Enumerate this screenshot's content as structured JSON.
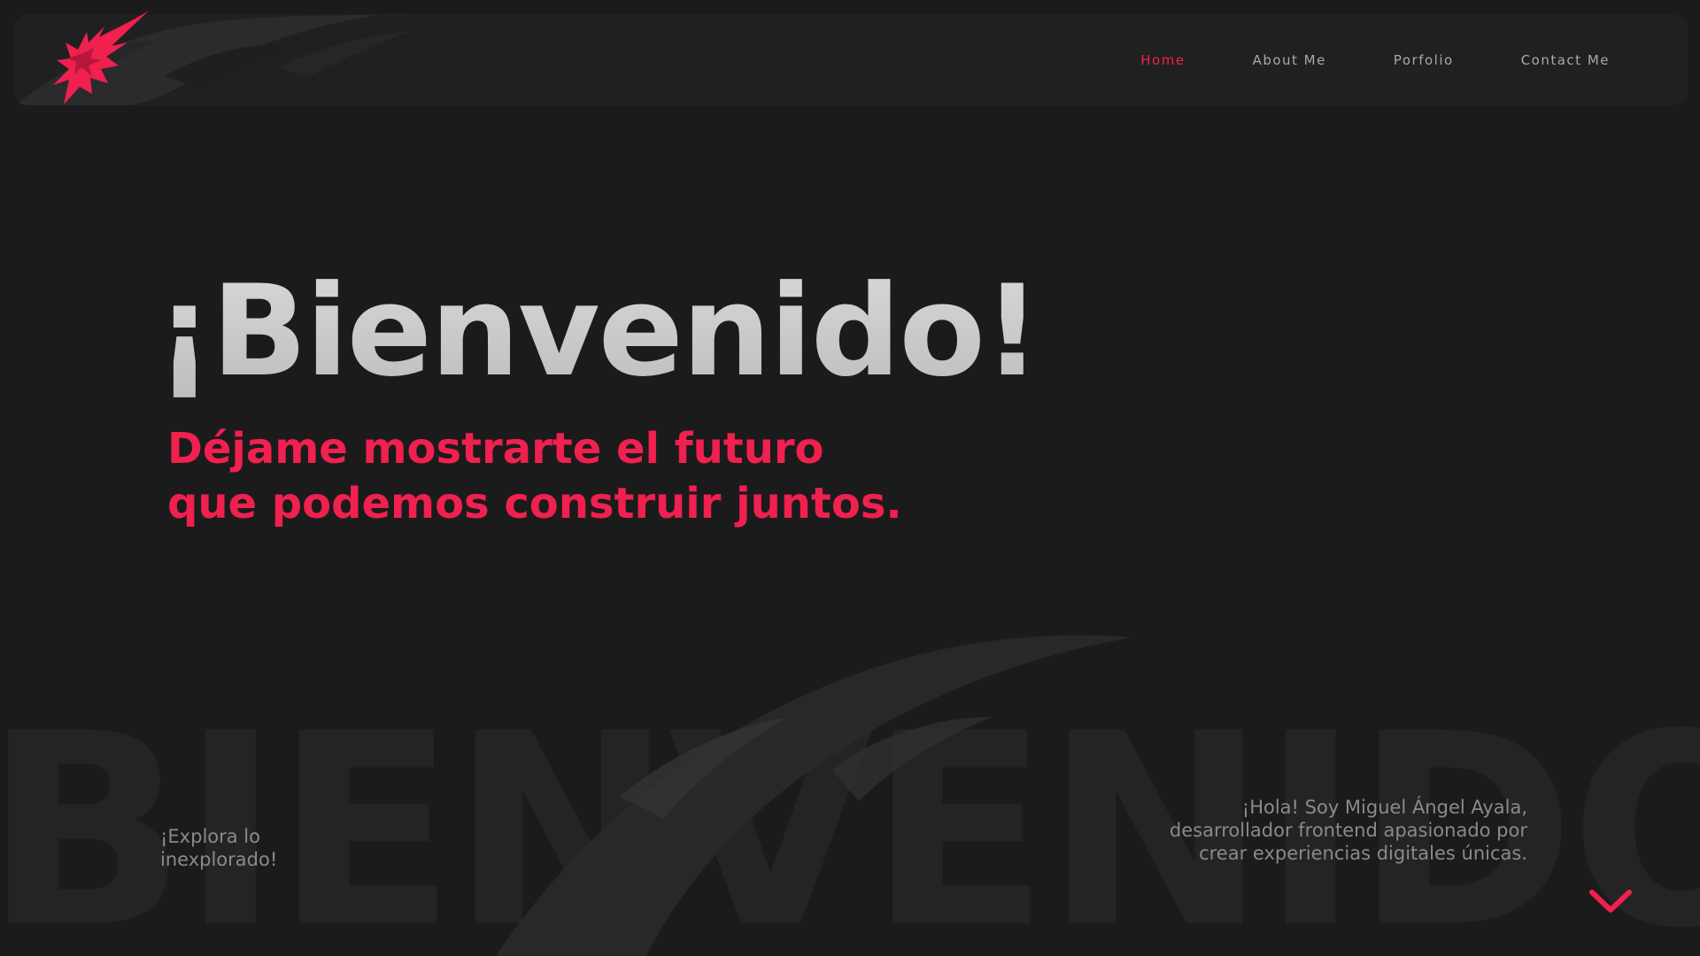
{
  "nav": {
    "items": [
      {
        "label": "Home"
      },
      {
        "label": "About Me"
      },
      {
        "label": "Porfolio"
      },
      {
        "label": "Contact Me"
      }
    ]
  },
  "hero": {
    "title": "¡Bienvenido!",
    "subtitle_line1": "Déjame mostrarte el futuro",
    "subtitle_line2": "que podemos construir juntos."
  },
  "background_word": "BIENVENIDO",
  "footer": {
    "explore_line1": "¡Explora lo",
    "explore_line2": "inexplorado!",
    "intro_line1": "¡Hola! Soy Miguel Ángel Ayala,",
    "intro_line2": "desarrollador frontend apasionado por",
    "intro_line3": "crear experiencias digitales únicas."
  },
  "icons": {
    "logo": "red-claw-logo-icon",
    "scroll": "chevron-down-icon"
  },
  "colors": {
    "accent": "#f0204f",
    "background": "#1b1b1c",
    "nav_bg": "#202021",
    "muted_text": "#a9a9ab"
  }
}
